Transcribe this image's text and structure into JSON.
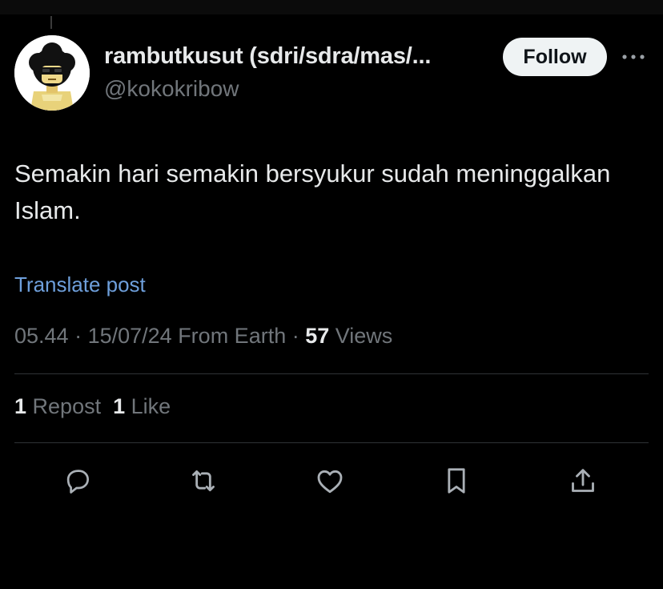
{
  "author": {
    "display_name": "rambutkusut (sdri/sdra/mas/...",
    "handle": "@kokokribow",
    "avatar_icon": "afro-sunglasses-avatar"
  },
  "follow_button": {
    "label": "Follow"
  },
  "more_menu": {
    "icon": "more-horizontal-icon"
  },
  "post": {
    "text": "Semakin hari semakin bersyukur sudah meninggalkan Islam.",
    "translate_label": "Translate post"
  },
  "meta": {
    "time": "05.44",
    "sep1": " · ",
    "date": "15/07/24",
    "source": " From Earth",
    "sep2": " · ",
    "views_count": "57",
    "views_label": " Views"
  },
  "stats": {
    "reposts_count": "1",
    "reposts_label": " Repost",
    "likes_count": "1",
    "likes_label": " Like"
  },
  "actions": [
    {
      "name": "reply",
      "icon": "reply-icon"
    },
    {
      "name": "repost",
      "icon": "repost-icon"
    },
    {
      "name": "like",
      "icon": "heart-icon"
    },
    {
      "name": "bookmark",
      "icon": "bookmark-icon"
    },
    {
      "name": "share",
      "icon": "share-icon"
    }
  ],
  "colors": {
    "background": "#000000",
    "text_primary": "#e7e9ea",
    "text_secondary": "#71767b",
    "link": "#6e9fdb",
    "divider": "#2f3336",
    "follow_bg": "#eff3f4"
  }
}
